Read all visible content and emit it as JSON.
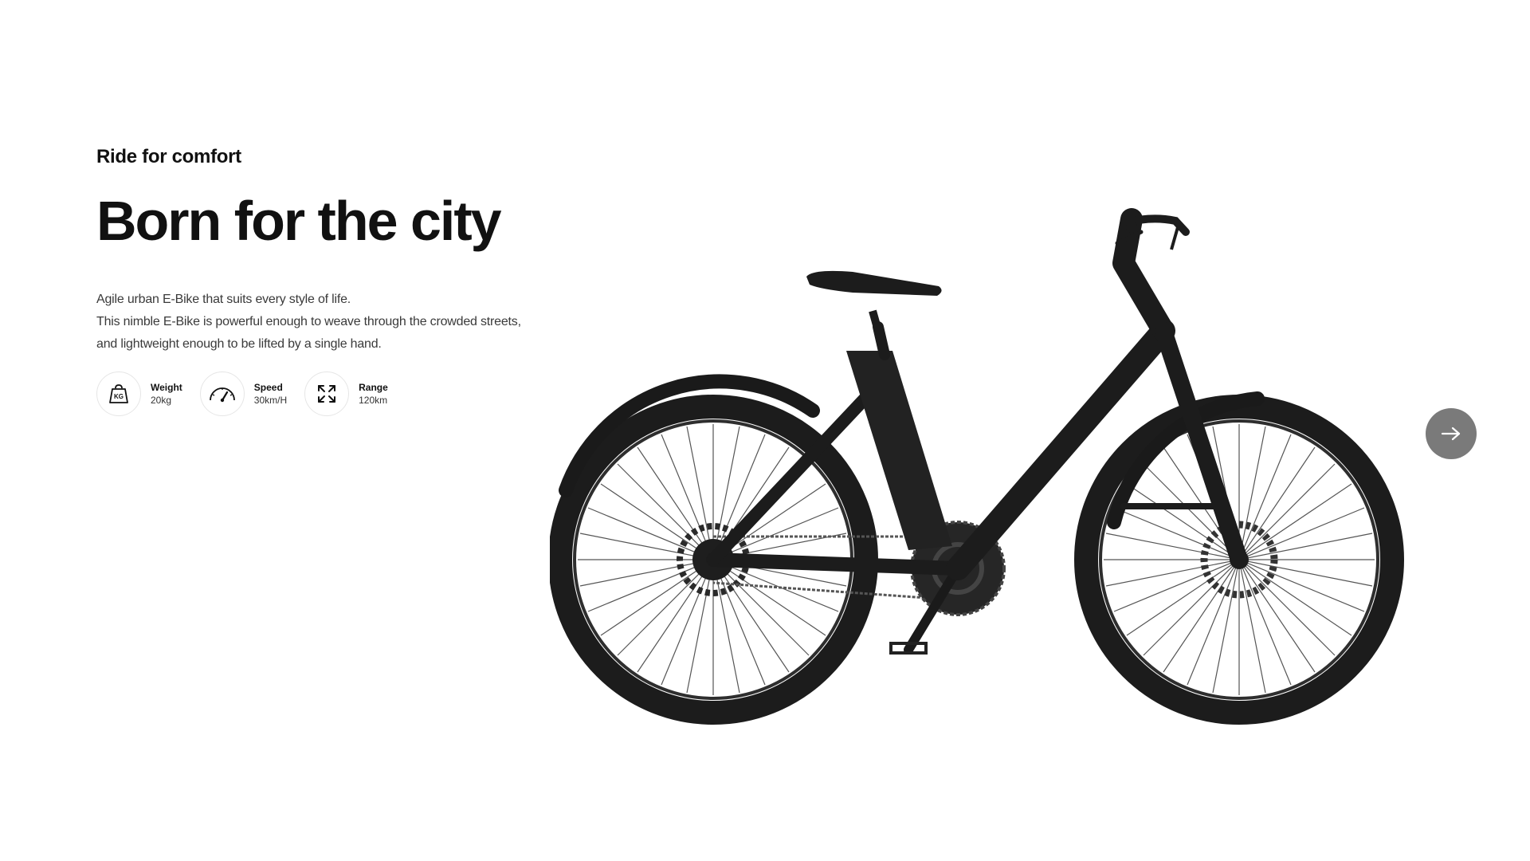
{
  "hero": {
    "eyebrow": "Ride for comfort",
    "headline": "Born for the city",
    "description": [
      "Agile urban E-Bike that suits every style of life.",
      "This nimble E-Bike is powerful enough to weave through the crowded streets,",
      "and lightweight enough to be lifted by a single hand."
    ]
  },
  "specs": [
    {
      "icon": "weight-kg-icon",
      "icon_text": "KG",
      "label": "Weight",
      "value": "20kg"
    },
    {
      "icon": "speedometer-icon",
      "label": "Speed",
      "value": "30km/H"
    },
    {
      "icon": "expand-arrows-icon",
      "label": "Range",
      "value": "120km"
    }
  ],
  "carousel": {
    "next_icon": "arrow-right-icon"
  },
  "colors": {
    "text": "#111111",
    "muted_text": "#3a3a3a",
    "bike": "#1c1c1c",
    "next_button_bg": "#7a7a7a"
  }
}
